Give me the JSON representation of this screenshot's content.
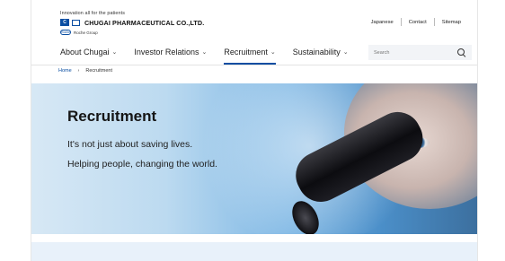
{
  "header": {
    "tagline": "Innovation all for the patients",
    "company_name": "CHUGAI PHARMACEUTICAL CO.,LTD.",
    "group_text": "Roche Group",
    "logo_mark_text": "C",
    "roche_badge_text": "Roche"
  },
  "utility_nav": {
    "japanese": "Japanese",
    "contact": "Contact",
    "sitemap": "Sitemap"
  },
  "main_nav": {
    "items": [
      {
        "label": "About Chugai",
        "active": false
      },
      {
        "label": "Investor Relations",
        "active": false
      },
      {
        "label": "Recruitment",
        "active": true
      },
      {
        "label": "Sustainability",
        "active": false
      }
    ],
    "chevron": "⌄"
  },
  "search": {
    "placeholder": "Search",
    "icon": "search-icon"
  },
  "breadcrumb": {
    "home": "Home",
    "separator": "›",
    "current": "Recruitment"
  },
  "hero": {
    "title": "Recruitment",
    "line1": "It's not just about saving lives.",
    "line2": "Helping people, changing the world."
  },
  "colors": {
    "accent": "#0a4ea2",
    "hero_light": "#d7e8f5",
    "hero_dark": "#3c6f9e",
    "band": "#e8f1fa"
  }
}
